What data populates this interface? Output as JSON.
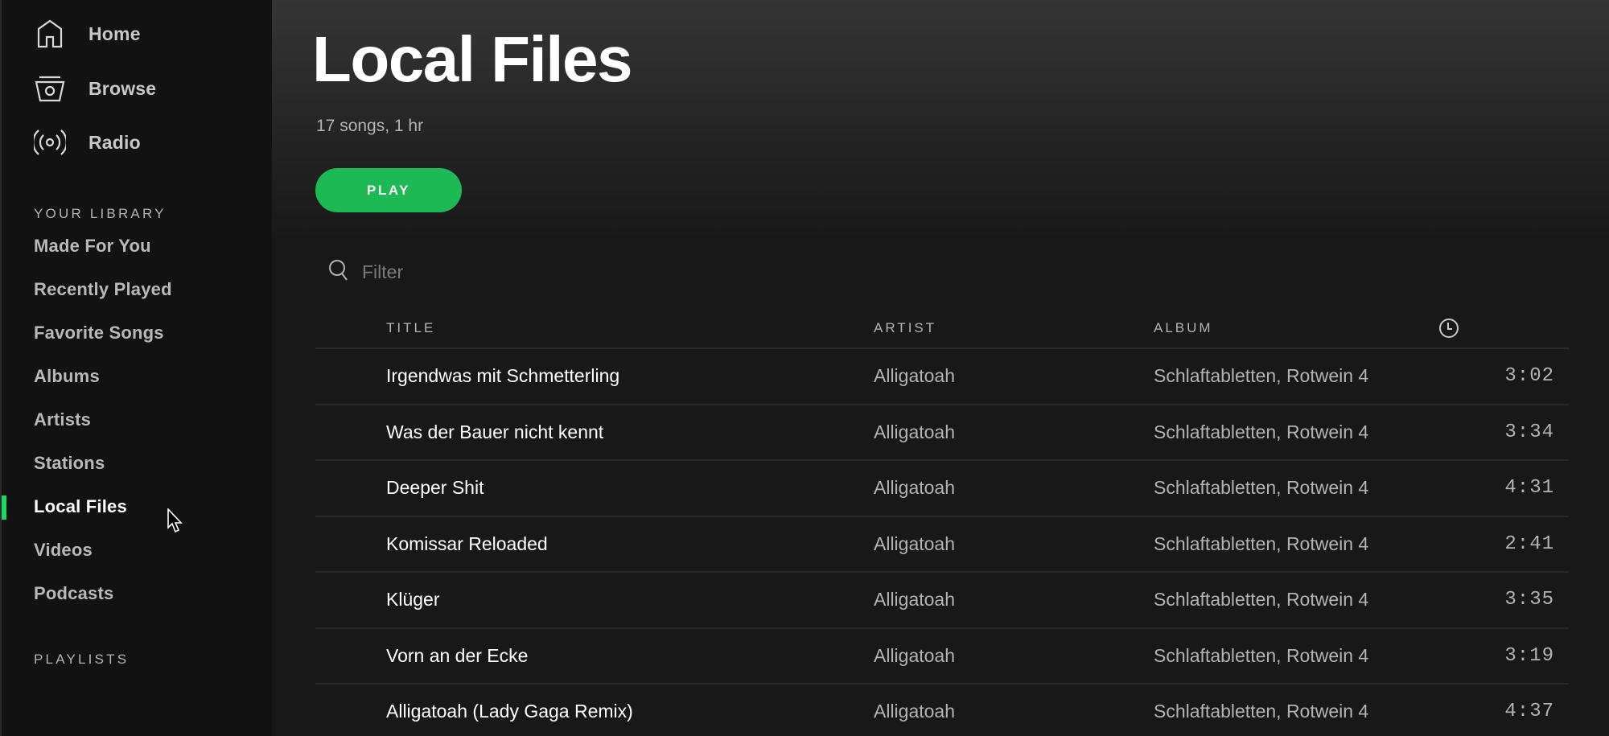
{
  "sidebar": {
    "nav": [
      {
        "label": "Home",
        "icon": "home-icon"
      },
      {
        "label": "Browse",
        "icon": "browse-icon"
      },
      {
        "label": "Radio",
        "icon": "radio-icon"
      }
    ],
    "library_heading": "YOUR LIBRARY",
    "library": [
      {
        "label": "Made For You"
      },
      {
        "label": "Recently Played"
      },
      {
        "label": "Favorite Songs"
      },
      {
        "label": "Albums"
      },
      {
        "label": "Artists"
      },
      {
        "label": "Stations"
      },
      {
        "label": "Local Files",
        "active": true
      },
      {
        "label": "Videos"
      },
      {
        "label": "Podcasts"
      }
    ],
    "playlists_heading": "PLAYLISTS"
  },
  "colors": {
    "accent": "#1db954",
    "active_indicator": "#1ed760",
    "sidebar_bg": "#121212",
    "main_bg": "#181818"
  },
  "main": {
    "title": "Local Files",
    "meta": "17 songs, 1 hr",
    "play_label": "PLAY",
    "filter_placeholder": "Filter",
    "filter_value": "",
    "columns": {
      "title": "TITLE",
      "artist": "ARTIST",
      "album": "ALBUM",
      "duration_icon": "clock-icon"
    },
    "tracks": [
      {
        "title": "Irgendwas mit Schmetterling",
        "artist": "Alligatoah",
        "album": "Schlaftabletten, Rotwein 4",
        "duration": "3:02"
      },
      {
        "title": "Was der Bauer nicht kennt",
        "artist": "Alligatoah",
        "album": "Schlaftabletten, Rotwein 4",
        "duration": "3:34"
      },
      {
        "title": "Deeper Shit",
        "artist": "Alligatoah",
        "album": "Schlaftabletten, Rotwein 4",
        "duration": "4:31"
      },
      {
        "title": "Komissar Reloaded",
        "artist": "Alligatoah",
        "album": "Schlaftabletten, Rotwein 4",
        "duration": "2:41"
      },
      {
        "title": "Klüger",
        "artist": "Alligatoah",
        "album": "Schlaftabletten, Rotwein 4",
        "duration": "3:35"
      },
      {
        "title": "Vorn an der Ecke",
        "artist": "Alligatoah",
        "album": "Schlaftabletten, Rotwein 4",
        "duration": "3:19"
      },
      {
        "title": "Alligatoah (Lady Gaga Remix)",
        "artist": "Alligatoah",
        "album": "Schlaftabletten, Rotwein 4",
        "duration": "4:37"
      }
    ]
  }
}
